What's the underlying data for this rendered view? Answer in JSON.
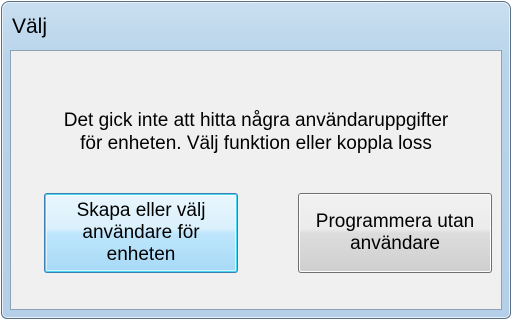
{
  "window": {
    "title": "Välj"
  },
  "dialog": {
    "message_line1": "Det gick inte att hitta några användaruppgifter",
    "message_line2": "för enheten. Välj funktion eller koppla loss",
    "buttons": {
      "create_or_select_label": "Skapa eller välj användare för enheten",
      "program_without_user_label": "Programmera utan användare"
    }
  },
  "colors": {
    "title_bar": "#b9d4ea",
    "client_bg": "#f0f0f0",
    "default_button": "#bee6fd",
    "default_button_border": "#3c7fb1",
    "normal_button_border": "#707070"
  }
}
